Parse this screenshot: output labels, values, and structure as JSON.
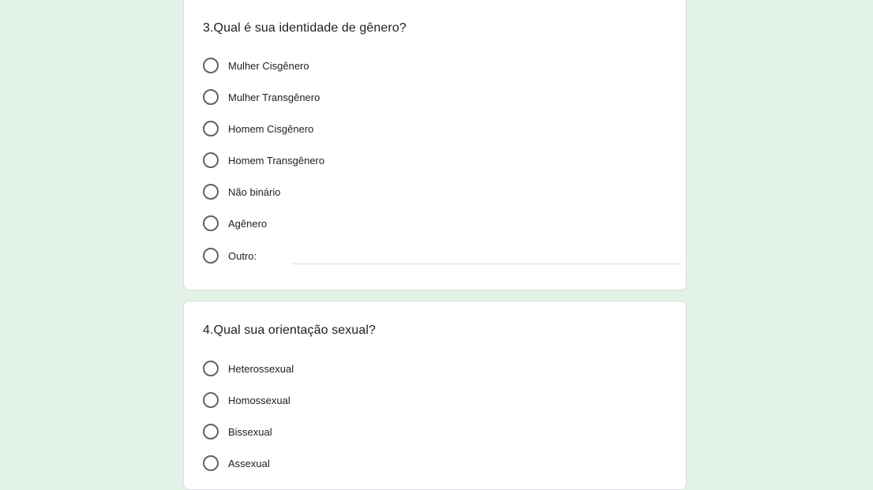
{
  "questions": [
    {
      "title": "3.Qual é sua identidade de gênero?",
      "options": [
        "Mulher Cisgênero",
        "Mulher Transgênero",
        "Homem Cisgênero",
        "Homem Transgênero",
        "Não binário",
        "Agênero"
      ],
      "other_label": "Outro:",
      "other_value": ""
    },
    {
      "title": "4.Qual sua orientação sexual?",
      "options": [
        "Heterossexual",
        "Homossexual",
        "Bissexual",
        "Assexual"
      ]
    }
  ],
  "colors": {
    "page_background": "#e3f2e6",
    "card_background": "#ffffff",
    "card_border": "#dadce0",
    "radio_border": "#5f6368",
    "text": "#202124"
  }
}
